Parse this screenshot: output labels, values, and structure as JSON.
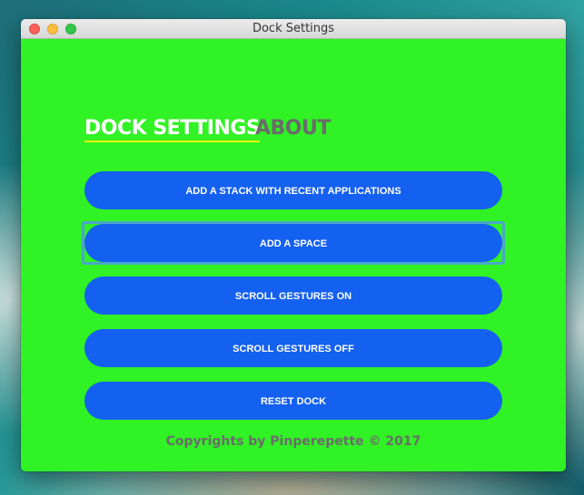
{
  "window": {
    "title": "Dock Settings"
  },
  "tabs": [
    {
      "label": "DOCK SETTINGS",
      "active": true
    },
    {
      "label": "ABOUT",
      "active": false
    }
  ],
  "buttons": [
    {
      "label": "ADD A STACK WITH RECENT APPLICATIONS"
    },
    {
      "label": "ADD A SPACE",
      "focused": true
    },
    {
      "label": "SCROLL GESTURES ON"
    },
    {
      "label": "SCROLL GESTURES OFF"
    },
    {
      "label": "RESET DOCK"
    }
  ],
  "footer": {
    "text": "Copyrights by Pinperepette © 2017"
  },
  "colors": {
    "background": "#30f224",
    "button": "#1460f0",
    "tab_underline": "#f2f20a",
    "inactive_text": "#6b6b6b"
  }
}
